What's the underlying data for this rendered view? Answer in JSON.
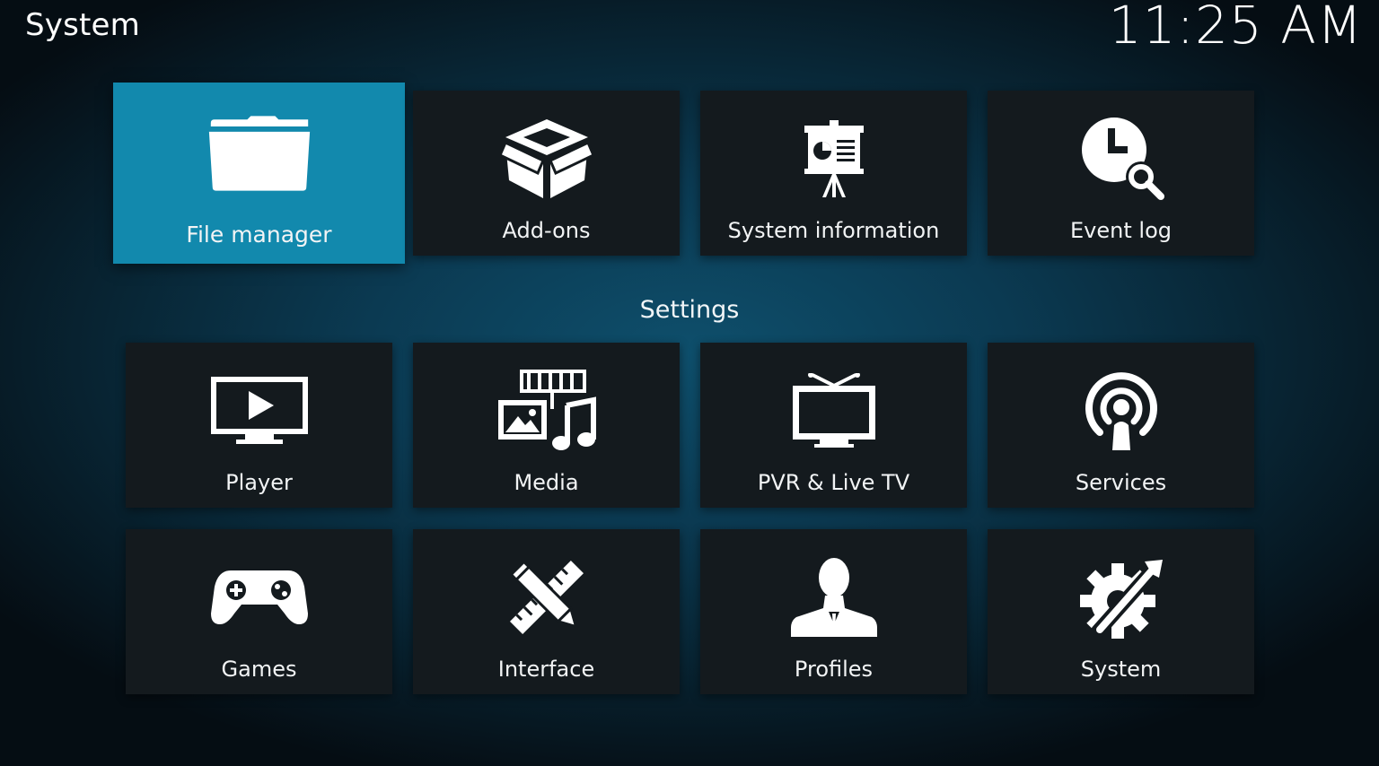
{
  "header": {
    "title": "System",
    "clock": "11:25 AM"
  },
  "section": {
    "settings_label": "Settings"
  },
  "top_row": [
    {
      "label": "File manager",
      "icon": "folder-icon",
      "focused": true
    },
    {
      "label": "Add-ons",
      "icon": "addons-box-icon",
      "focused": false
    },
    {
      "label": "System information",
      "icon": "presentation-board-icon",
      "focused": false
    },
    {
      "label": "Event log",
      "icon": "clock-search-icon",
      "focused": false
    }
  ],
  "settings_rows": [
    {
      "label": "Player",
      "icon": "tv-play-icon"
    },
    {
      "label": "Media",
      "icon": "media-film-photo-music-icon"
    },
    {
      "label": "PVR & Live TV",
      "icon": "tv-antenna-icon"
    },
    {
      "label": "Services",
      "icon": "broadcast-person-icon"
    },
    {
      "label": "Games",
      "icon": "gamepad-icon"
    },
    {
      "label": "Interface",
      "icon": "pencil-ruler-icon"
    },
    {
      "label": "Profiles",
      "icon": "user-silhouette-icon"
    },
    {
      "label": "System",
      "icon": "gear-wrench-icon"
    }
  ],
  "colors": {
    "focus_accent": "#1289ad",
    "tile_background": "#141a1e"
  }
}
